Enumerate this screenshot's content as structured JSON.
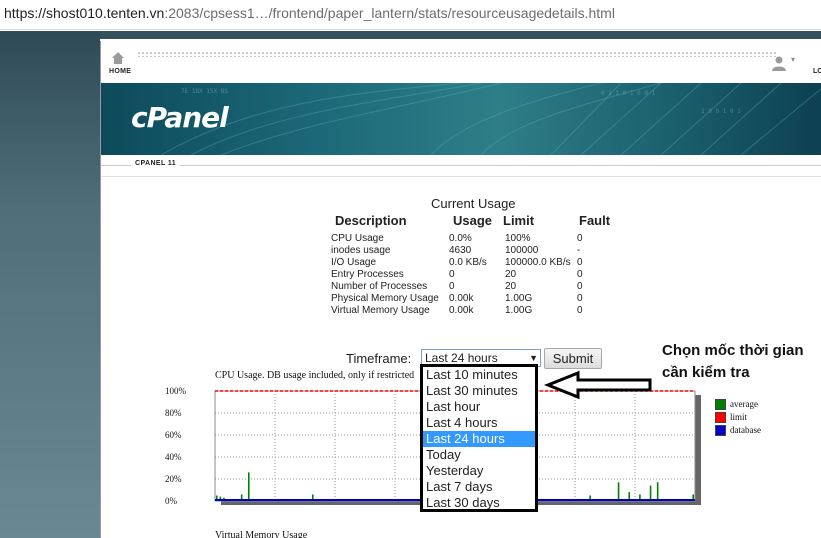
{
  "address_bar": {
    "host": "https://shost010.tenten.vn",
    "path": ":2083/cpsess1…/frontend/paper_lantern/stats/resourceusagedetails.html"
  },
  "nav": {
    "home_label": "HOME",
    "logout_label": "LO"
  },
  "brand": {
    "logo_text": "cPanel",
    "version_label": "CPANEL 11"
  },
  "usage": {
    "title": "Current Usage",
    "headers": [
      "Description",
      "Usage",
      "Limit",
      "Fault"
    ],
    "rows": [
      [
        "CPU Usage",
        "0.0%",
        "100%",
        "0"
      ],
      [
        "inodes usage",
        "4630",
        "100000",
        "-"
      ],
      [
        "I/O Usage",
        "0.0 KB/s",
        "100000.0 KB/s",
        "0"
      ],
      [
        "Entry Processes",
        "0",
        "20",
        "0"
      ],
      [
        "Number of Processes",
        "0",
        "20",
        "0"
      ],
      [
        "Physical Memory Usage",
        "0.00k",
        "1.00G",
        "0"
      ],
      [
        "Virtual Memory Usage",
        "0.00k",
        "1.00G",
        "0"
      ]
    ]
  },
  "timeframe": {
    "label": "Timeframe:",
    "selected": "Last 24 hours",
    "options": [
      "Last 10 minutes",
      "Last 30 minutes",
      "Last hour",
      "Last 4 hours",
      "Last 24 hours",
      "Today",
      "Yesterday",
      "Last 7 days",
      "Last 30 days"
    ],
    "submit_label": "Submit"
  },
  "chart_data": {
    "type": "bar",
    "title": "CPU Usage. DB usage included, only if restricted",
    "yticks": [
      "100%",
      "80%",
      "60%",
      "40%",
      "20%",
      "0%"
    ],
    "ylim": [
      0,
      100
    ],
    "limit": 100,
    "series": [
      {
        "name": "average",
        "color": "#008000",
        "values": [
          5,
          4,
          3,
          0,
          0,
          0,
          0,
          6,
          0,
          26,
          0,
          0,
          0,
          0,
          0,
          0,
          0,
          0,
          0,
          0,
          0,
          0,
          0,
          0,
          0,
          0,
          0,
          6,
          0,
          0,
          0,
          0,
          0,
          0,
          0,
          0,
          0,
          0,
          0,
          0,
          0,
          0,
          0,
          0,
          0,
          0,
          0,
          0,
          0,
          0,
          0,
          0,
          0,
          0,
          0,
          0,
          0,
          0,
          0,
          0,
          0,
          0,
          0,
          0,
          0,
          0,
          0,
          0,
          0,
          0,
          0,
          0,
          0,
          0,
          0,
          0,
          0,
          18,
          0,
          0,
          0,
          0,
          0,
          8,
          0,
          0,
          0,
          0,
          0,
          0,
          0,
          0,
          0,
          0,
          0,
          0,
          0,
          0,
          0,
          0,
          0,
          0,
          0,
          0,
          0,
          5,
          0,
          0,
          0,
          0,
          0,
          0,
          0,
          17,
          0,
          0,
          8,
          0,
          0,
          6,
          0,
          0,
          14,
          0,
          17,
          0,
          0,
          0,
          0,
          0,
          0,
          0,
          0,
          0,
          6
        ]
      },
      {
        "name": "limit",
        "color": "#ff0000"
      },
      {
        "name": "database",
        "color": "#0000cc"
      }
    ],
    "grid": true,
    "legend": "right"
  },
  "secondary_chart_title": "Virtual Memory Usage",
  "annotation": {
    "line1": "Chọn mốc thời gian",
    "line2": "cần kiểm tra"
  }
}
